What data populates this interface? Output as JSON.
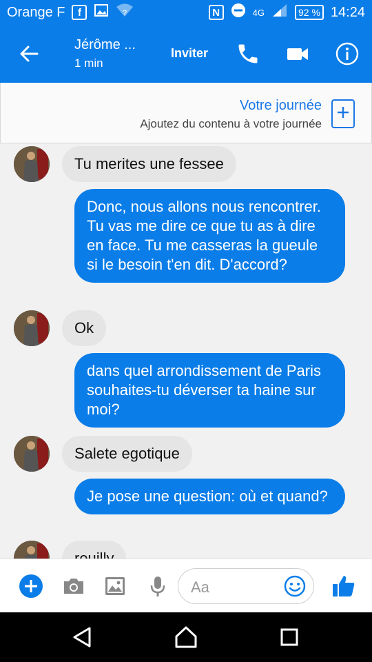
{
  "status_bar": {
    "carrier": "Orange F",
    "network": "4G",
    "battery": "92 %",
    "time": "14:24"
  },
  "header": {
    "contact_name": "Jérôme ...",
    "contact_status": "1 min",
    "invite_label": "Inviter"
  },
  "story": {
    "title": "Votre journée",
    "subtitle": "Ajoutez du contenu à votre journée"
  },
  "messages": [
    {
      "side": "in",
      "text": "Tu merites une fessee"
    },
    {
      "side": "out",
      "text": "Donc, nous allons nous rencontrer. Tu vas me dire ce que tu as à dire en face. Tu me casseras la gueule si le besoin t'en dit. D'accord?"
    },
    {
      "side": "in",
      "text": "Ok"
    },
    {
      "side": "out",
      "text": "dans quel arrondissement de Paris souhaites-tu déverser ta haine sur moi?"
    },
    {
      "side": "in",
      "text": "Salete egotique"
    },
    {
      "side": "out",
      "text": "Je pose une question: où et quand?"
    },
    {
      "side": "in",
      "text": "reuilly"
    }
  ],
  "composer": {
    "placeholder": "Aa"
  },
  "colors": {
    "brand_blue": "#0a7de8",
    "incoming_bubble": "#e5e5e5",
    "background": "#f1f1f1"
  }
}
